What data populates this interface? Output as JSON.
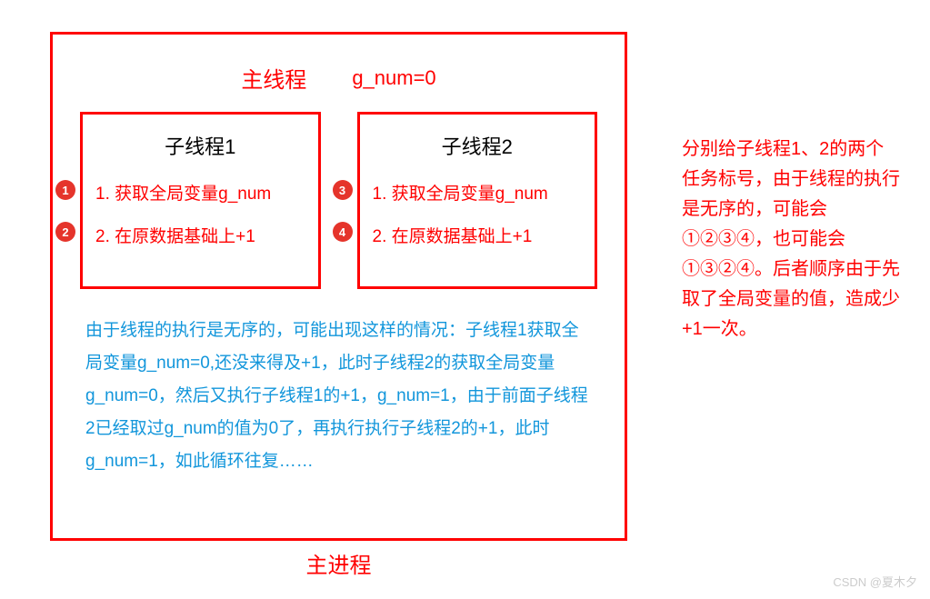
{
  "header": {
    "title": "主线程",
    "variable": "g_num=0"
  },
  "threads": [
    {
      "title": "子线程1",
      "steps": [
        {
          "badge": "1",
          "text": "1. 获取全局变量g_num"
        },
        {
          "badge": "2",
          "text": "2. 在原数据基础上+1"
        }
      ]
    },
    {
      "title": "子线程2",
      "steps": [
        {
          "badge": "3",
          "text": "1. 获取全局变量g_num"
        },
        {
          "badge": "4",
          "text": "2. 在原数据基础上+1"
        }
      ]
    }
  ],
  "explanation": "由于线程的执行是无序的，可能出现这样的情况：子线程1获取全局变量g_num=0,还没来得及+1，此时子线程2的获取全局变量g_num=0，然后又执行子线程1的+1，g_num=1，由于前面子线程2已经取过g_num的值为0了，再执行执行子线程2的+1，此时g_num=1，如此循环往复……",
  "main_process_label": "主进程",
  "side_note": "分别给子线程1、2的两个任务标号，由于线程的执行是无序的，可能会①②③④，也可能会①③②④。后者顺序由于先取了全局变量的值，造成少+1一次。",
  "watermark": "CSDN @夏木夕"
}
